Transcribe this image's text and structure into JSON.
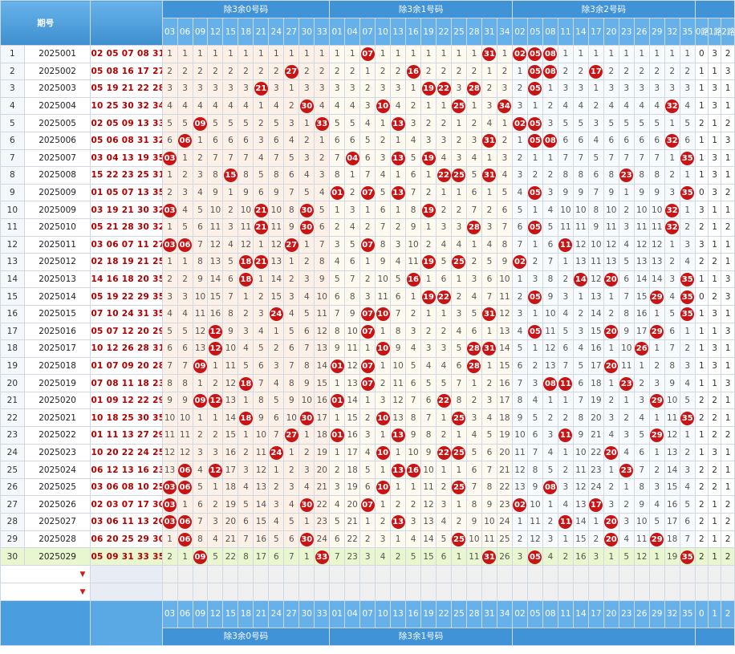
{
  "header": {
    "title_period": "期号",
    "group_labels": [
      "除3余0号码",
      "除3余1号码",
      "除3余2号码"
    ],
    "road_labels": [
      "0路",
      "1路",
      "2路"
    ]
  },
  "columns": {
    "zone0": [
      "03",
      "06",
      "09",
      "12",
      "15",
      "18",
      "21",
      "24",
      "27",
      "30",
      "33"
    ],
    "zone1": [
      "01",
      "04",
      "07",
      "10",
      "13",
      "16",
      "19",
      "22",
      "25",
      "28",
      "31",
      "34"
    ],
    "zone2": [
      "02",
      "05",
      "08",
      "11",
      "14",
      "17",
      "20",
      "23",
      "26",
      "29",
      "32",
      "35"
    ]
  },
  "rows": [
    {
      "idx": "1",
      "period": "2025001",
      "draws": "02 05 07 08 31",
      "balls": [
        "02",
        "05",
        "07",
        "08",
        "31"
      ],
      "road": [
        "0",
        "3",
        "2"
      ]
    },
    {
      "idx": "2",
      "period": "2025002",
      "draws": "05 08 16 17 27",
      "balls": [
        "05",
        "08",
        "16",
        "17",
        "27"
      ],
      "road": [
        "1",
        "1",
        "3"
      ]
    },
    {
      "idx": "3",
      "period": "2025003",
      "draws": "05 19 21 22 28",
      "balls": [
        "05",
        "19",
        "21",
        "22",
        "28"
      ],
      "road": [
        "1",
        "3",
        "1"
      ]
    },
    {
      "idx": "4",
      "period": "2025004",
      "draws": "10 25 30 32 34",
      "balls": [
        "10",
        "25",
        "30",
        "32",
        "34"
      ],
      "road": [
        "1",
        "3",
        "1"
      ]
    },
    {
      "idx": "5",
      "period": "2025005",
      "draws": "02 05 09 13 33",
      "balls": [
        "02",
        "05",
        "09",
        "13",
        "33"
      ],
      "road": [
        "2",
        "1",
        "2"
      ]
    },
    {
      "idx": "6",
      "period": "2025006",
      "draws": "05 06 08 31 32",
      "balls": [
        "05",
        "06",
        "08",
        "31",
        "32"
      ],
      "road": [
        "1",
        "1",
        "3"
      ]
    },
    {
      "idx": "7",
      "period": "2025007",
      "draws": "03 04 13 19 35",
      "balls": [
        "03",
        "04",
        "13",
        "19",
        "35"
      ],
      "road": [
        "1",
        "3",
        "1"
      ]
    },
    {
      "idx": "8",
      "period": "2025008",
      "draws": "15 22 23 25 31",
      "balls": [
        "15",
        "22",
        "23",
        "25",
        "31"
      ],
      "road": [
        "1",
        "3",
        "1"
      ]
    },
    {
      "idx": "9",
      "period": "2025009",
      "draws": "01 05 07 13 35",
      "balls": [
        "01",
        "05",
        "07",
        "13",
        "35"
      ],
      "road": [
        "0",
        "3",
        "2"
      ]
    },
    {
      "idx": "10",
      "period": "2025009",
      "draws": "03 19 21 30 32",
      "balls": [
        "03",
        "19",
        "21",
        "30",
        "32"
      ],
      "road": [
        "3",
        "1",
        "1"
      ]
    },
    {
      "idx": "11",
      "period": "2025010",
      "draws": "05 21 28 30 32",
      "balls": [
        "05",
        "21",
        "28",
        "30",
        "32"
      ],
      "road": [
        "2",
        "1",
        "2"
      ]
    },
    {
      "idx": "12",
      "period": "2025011",
      "draws": "03 06 07 11 27",
      "balls": [
        "03",
        "06",
        "07",
        "11",
        "27"
      ],
      "road": [
        "3",
        "1",
        "1"
      ]
    },
    {
      "idx": "13",
      "period": "2025012",
      "draws": "02 18 19 21 25",
      "balls": [
        "02",
        "18",
        "19",
        "21",
        "25"
      ],
      "road": [
        "2",
        "2",
        "1"
      ]
    },
    {
      "idx": "14",
      "period": "2025013",
      "draws": "14 16 18 20 35",
      "balls": [
        "14",
        "16",
        "18",
        "20",
        "35"
      ],
      "road": [
        "1",
        "1",
        "3"
      ]
    },
    {
      "idx": "15",
      "period": "2025014",
      "draws": "05 19 22 29 35",
      "balls": [
        "05",
        "19",
        "22",
        "29",
        "35"
      ],
      "road": [
        "0",
        "2",
        "3"
      ]
    },
    {
      "idx": "16",
      "period": "2025015",
      "draws": "07 10 24 31 35",
      "balls": [
        "07",
        "10",
        "24",
        "31",
        "35"
      ],
      "road": [
        "1",
        "3",
        "1"
      ]
    },
    {
      "idx": "17",
      "period": "2025016",
      "draws": "05 07 12 20 29",
      "balls": [
        "05",
        "07",
        "12",
        "20",
        "29"
      ],
      "road": [
        "1",
        "1",
        "3"
      ]
    },
    {
      "idx": "18",
      "period": "2025017",
      "draws": "10 12 26 28 31",
      "balls": [
        "10",
        "12",
        "26",
        "28",
        "31"
      ],
      "road": [
        "1",
        "3",
        "1"
      ]
    },
    {
      "idx": "19",
      "period": "2025018",
      "draws": "01 07 09 20 28",
      "balls": [
        "01",
        "07",
        "09",
        "20",
        "28"
      ],
      "road": [
        "1",
        "3",
        "1"
      ]
    },
    {
      "idx": "20",
      "period": "2025019",
      "draws": "07 08 11 18 23",
      "balls": [
        "07",
        "08",
        "11",
        "18",
        "23"
      ],
      "road": [
        "1",
        "1",
        "3"
      ]
    },
    {
      "idx": "21",
      "period": "2025020",
      "draws": "01 09 12 22 29",
      "balls": [
        "01",
        "09",
        "12",
        "22",
        "29"
      ],
      "road": [
        "2",
        "2",
        "1"
      ]
    },
    {
      "idx": "22",
      "period": "2025021",
      "draws": "10 18 25 30 35",
      "balls": [
        "10",
        "18",
        "25",
        "30",
        "35"
      ],
      "road": [
        "2",
        "2",
        "1"
      ]
    },
    {
      "idx": "23",
      "period": "2025022",
      "draws": "01 11 13 27 29",
      "balls": [
        "01",
        "11",
        "13",
        "27",
        "29"
      ],
      "road": [
        "1",
        "2",
        "2"
      ]
    },
    {
      "idx": "24",
      "period": "2025023",
      "draws": "10 20 22 24 25",
      "balls": [
        "10",
        "20",
        "22",
        "24",
        "25"
      ],
      "road": [
        "1",
        "3",
        "1"
      ]
    },
    {
      "idx": "25",
      "period": "2025024",
      "draws": "06 12 13 16 23",
      "balls": [
        "06",
        "12",
        "13",
        "16",
        "23"
      ],
      "road": [
        "2",
        "2",
        "1"
      ]
    },
    {
      "idx": "26",
      "period": "2025025",
      "draws": "03 06 08 10 25",
      "balls": [
        "03",
        "06",
        "08",
        "10",
        "25"
      ],
      "road": [
        "2",
        "2",
        "1"
      ]
    },
    {
      "idx": "27",
      "period": "2025026",
      "draws": "02 03 07 17 30",
      "balls": [
        "02",
        "03",
        "07",
        "17",
        "30"
      ],
      "road": [
        "2",
        "1",
        "2"
      ]
    },
    {
      "idx": "28",
      "period": "2025027",
      "draws": "03 06 11 13 20",
      "balls": [
        "03",
        "06",
        "11",
        "13",
        "20"
      ],
      "road": [
        "2",
        "1",
        "2"
      ]
    },
    {
      "idx": "29",
      "period": "2025028",
      "draws": "06 20 25 29 30",
      "balls": [
        "06",
        "20",
        "25",
        "29",
        "30"
      ],
      "road": [
        "2",
        "1",
        "2"
      ]
    },
    {
      "idx": "30",
      "period": "2025029",
      "draws": "05 09 31 33 35",
      "balls": [
        "05",
        "09",
        "31",
        "33",
        "35"
      ],
      "road": [
        "2",
        "1",
        "2"
      ]
    }
  ],
  "footer": {
    "group_labels": [
      "除3余0号码",
      "除3余1号码"
    ],
    "road_partial": [
      "0",
      "1",
      "2"
    ]
  },
  "colors": {
    "header_blue": "#5aa9e4",
    "ball_red": "#c81414",
    "last_row": "#e9f7d0"
  }
}
